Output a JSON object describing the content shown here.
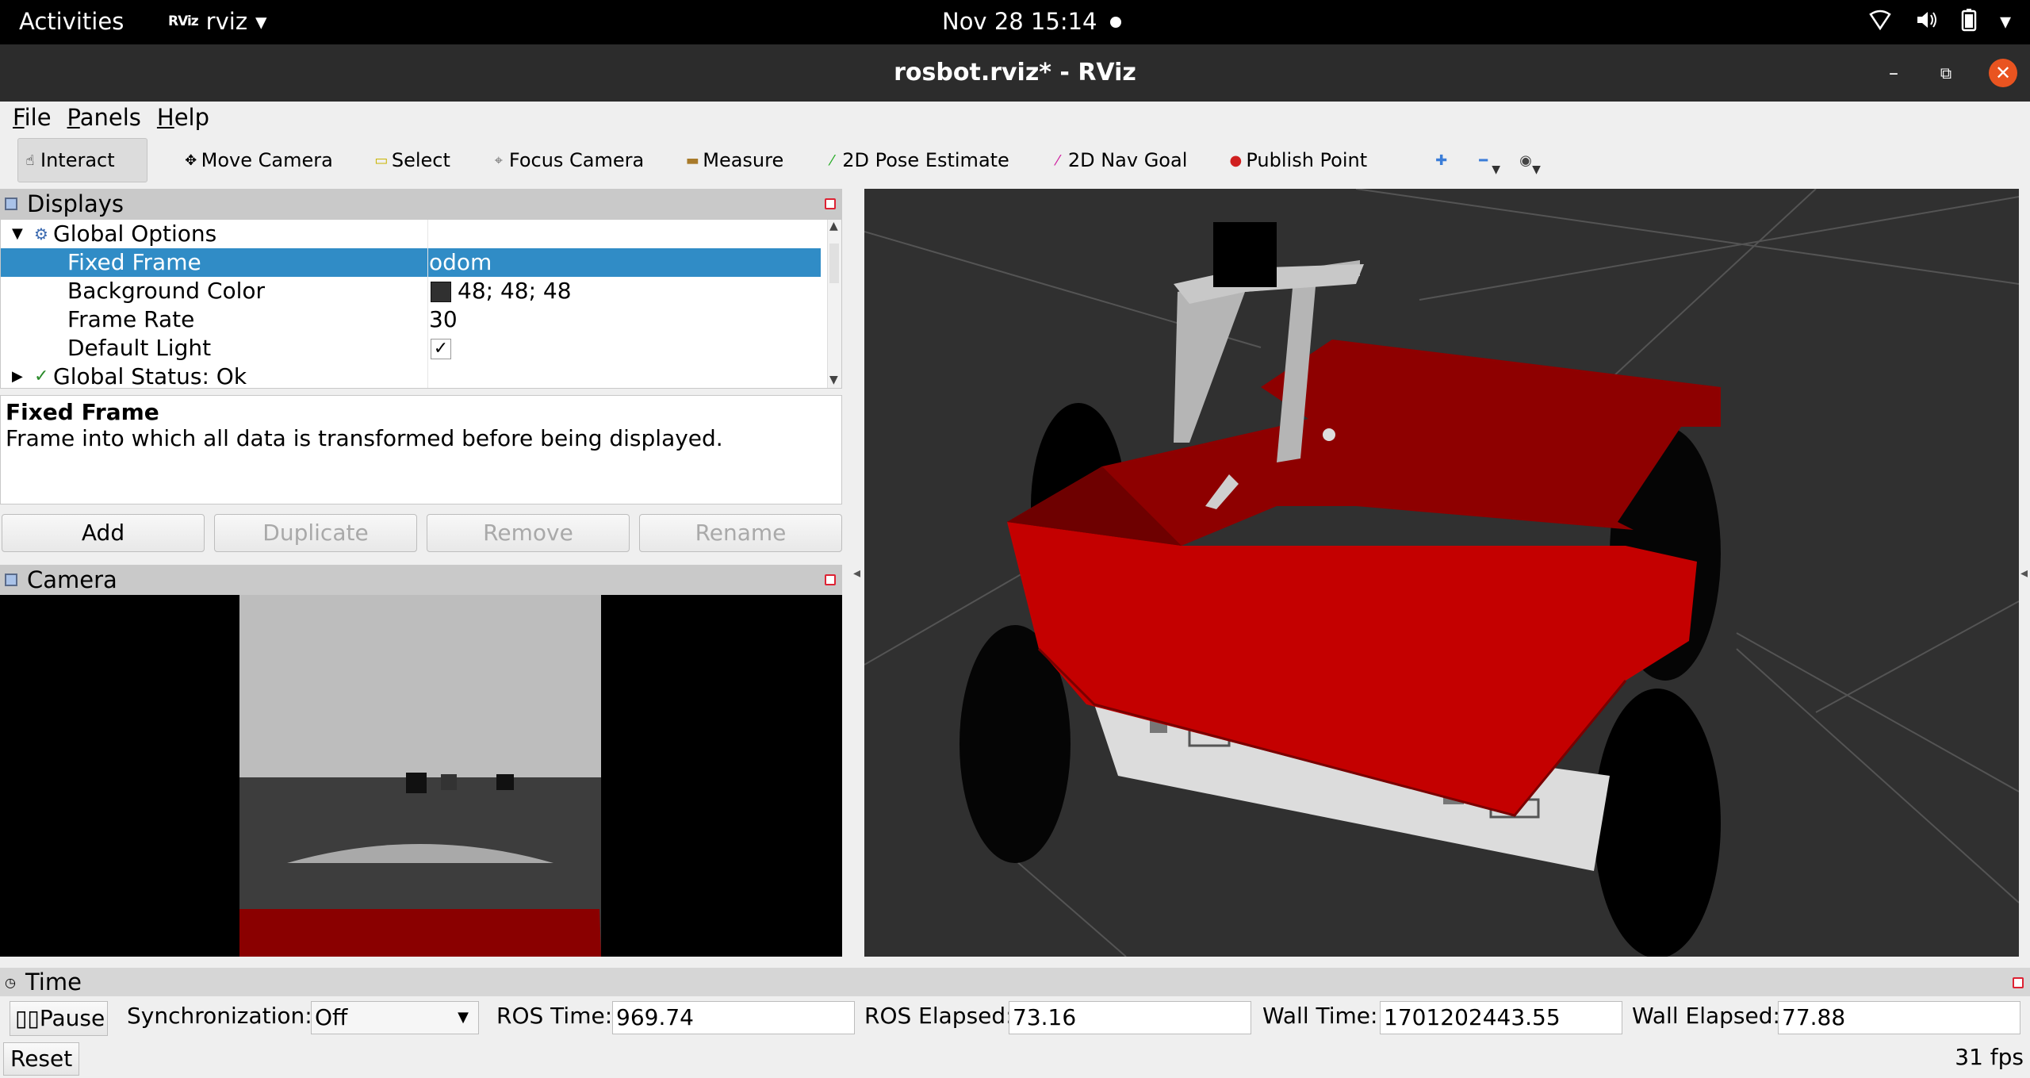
{
  "topbar": {
    "activities": "Activities",
    "app_logo": "RViz",
    "app_name": "rviz",
    "clock": "Nov 28  15:14",
    "tray_icons": [
      "network-icon",
      "volume-icon",
      "battery-icon"
    ]
  },
  "window": {
    "title": "rosbot.rviz* - RViz"
  },
  "menu": {
    "file": "File",
    "panels": "Panels",
    "help": "Help"
  },
  "toolbar": {
    "interact": "Interact",
    "move_camera": "Move Camera",
    "select": "Select",
    "focus_camera": "Focus Camera",
    "measure": "Measure",
    "pose_estimate": "2D Pose Estimate",
    "nav_goal": "2D Nav Goal",
    "publish_point": "Publish Point"
  },
  "displays": {
    "title": "Displays",
    "rows": [
      {
        "name": "Global Options",
        "value": ""
      },
      {
        "name": "Fixed Frame",
        "value": "odom"
      },
      {
        "name": "Background Color",
        "value": "48; 48; 48",
        "swatch": "#303030"
      },
      {
        "name": "Frame Rate",
        "value": "30"
      },
      {
        "name": "Default Light",
        "value": "✓"
      },
      {
        "name": "Global Status: Ok",
        "value": ""
      }
    ],
    "desc_title": "Fixed Frame",
    "desc_text": "Frame into which all data is transformed before being displayed.",
    "buttons": {
      "add": "Add",
      "duplicate": "Duplicate",
      "remove": "Remove",
      "rename": "Rename"
    }
  },
  "camera": {
    "title": "Camera"
  },
  "time": {
    "title": "Time",
    "pause": "Pause",
    "sync_label": "Synchronization:",
    "sync_value": "Off",
    "ros_time_label": "ROS Time:",
    "ros_time": "969.74",
    "ros_elapsed_label": "ROS Elapsed:",
    "ros_elapsed": "73.16",
    "wall_time_label": "Wall Time:",
    "wall_time": "1701202443.55",
    "wall_elapsed_label": "Wall Elapsed:",
    "wall_elapsed": "77.88",
    "reset": "Reset",
    "fps": "31 fps"
  },
  "colors": {
    "selection": "#308cc6",
    "background": "#303030",
    "robot_red": "#c40000",
    "close_button": "#e95420"
  }
}
